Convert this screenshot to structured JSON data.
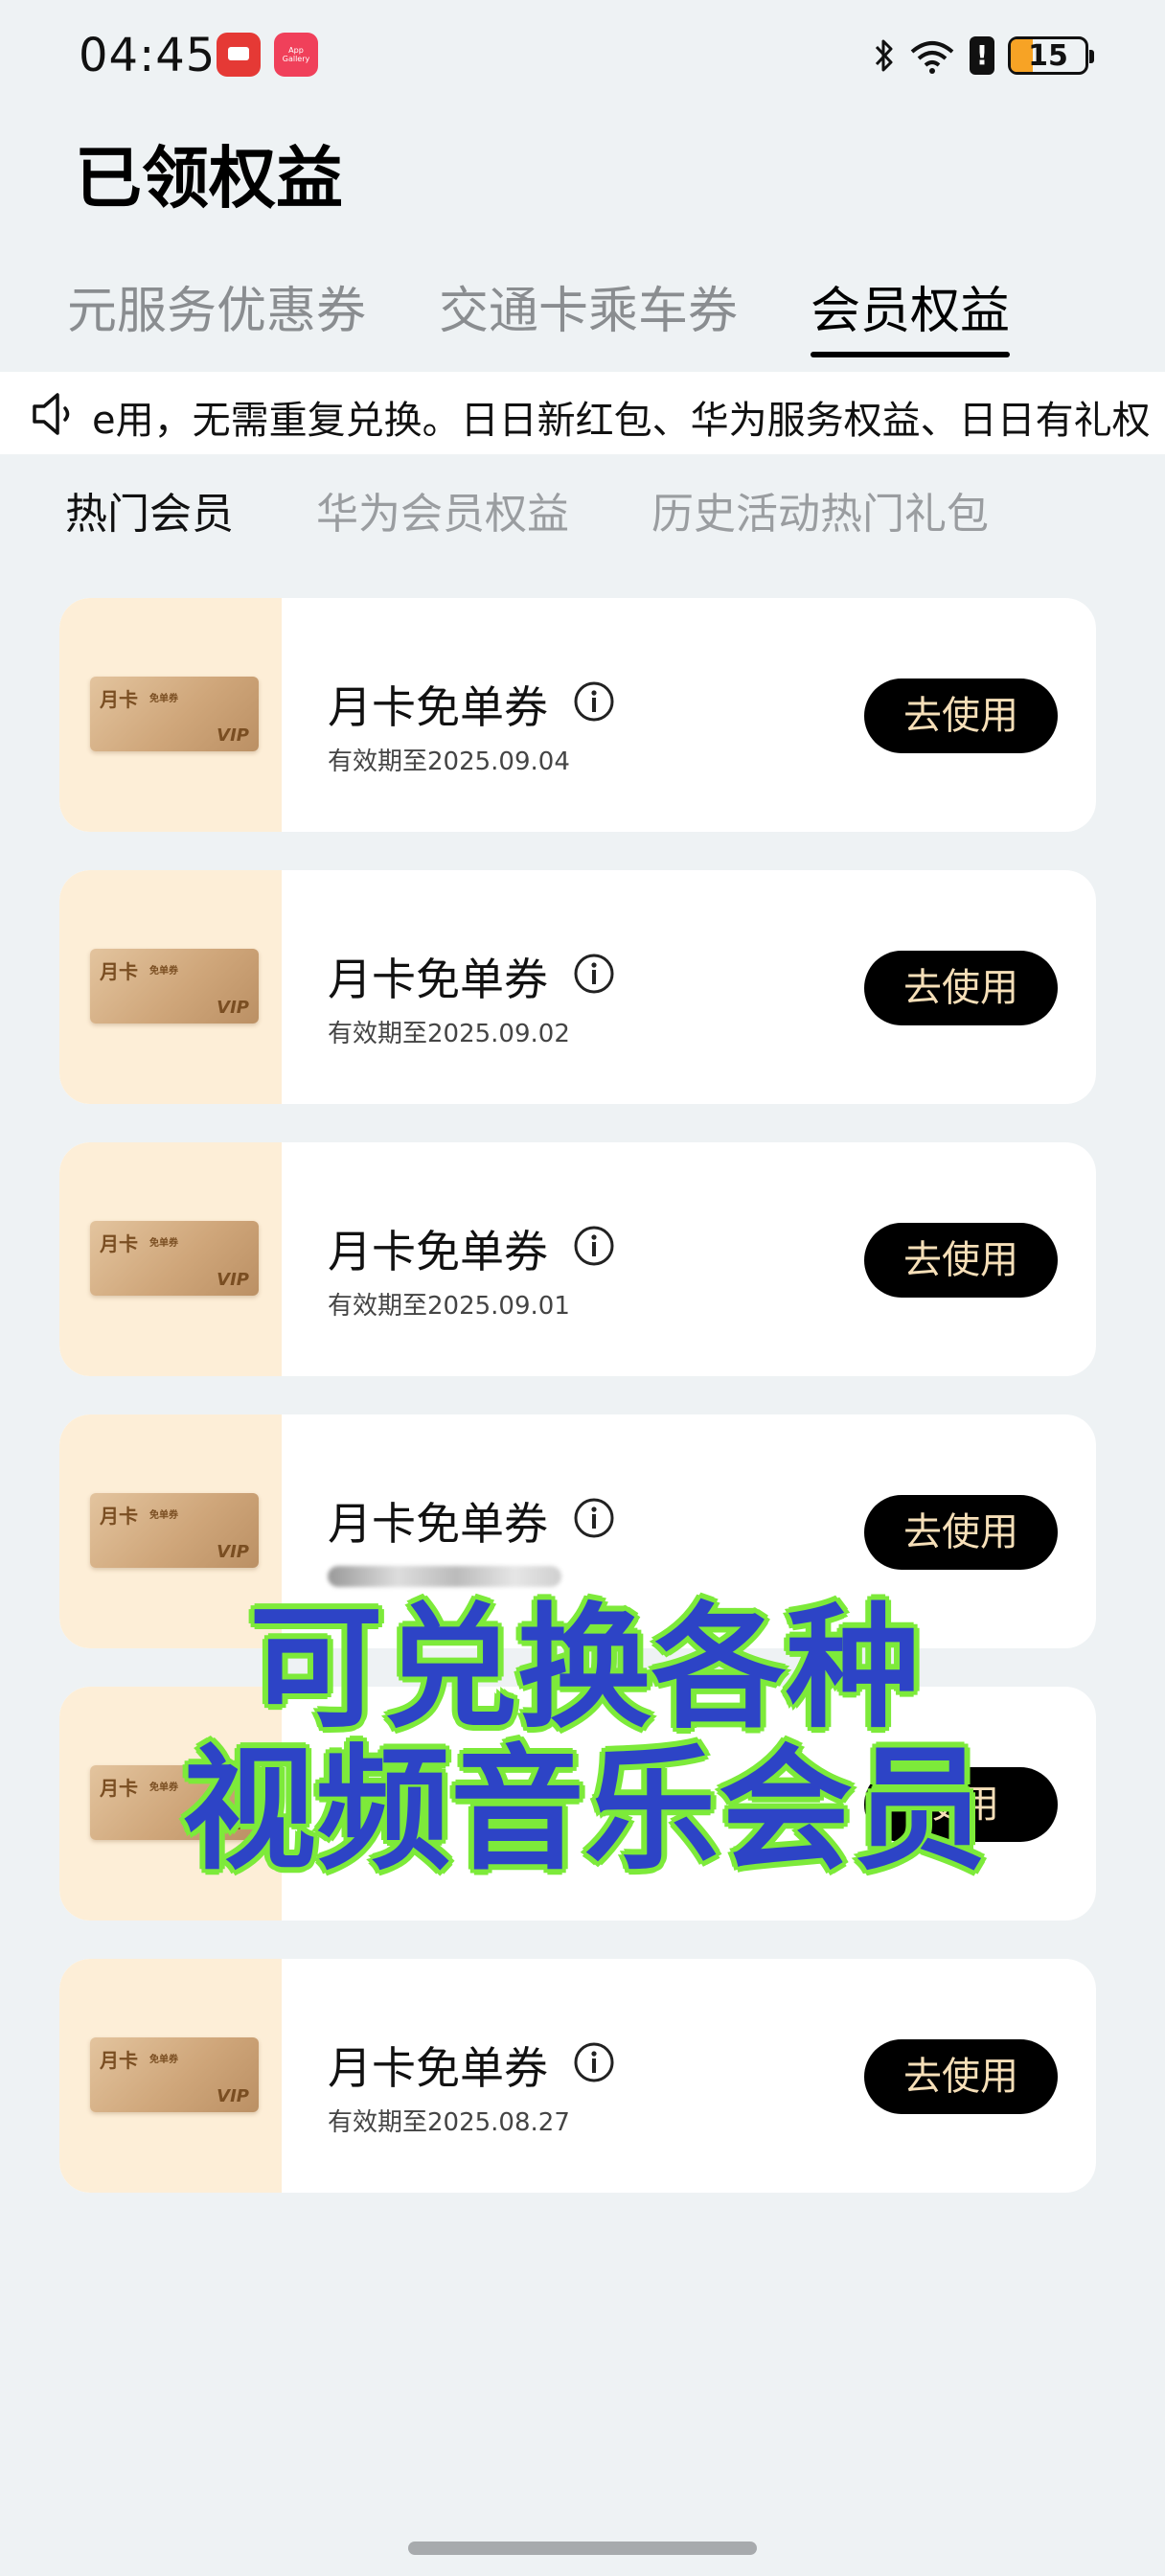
{
  "status_bar": {
    "time": "04:45",
    "battery": "15",
    "app_badge_2": "App Gallery"
  },
  "page": {
    "title": "已领权益"
  },
  "top_tabs": [
    {
      "label": "元服务优惠券",
      "active": false
    },
    {
      "label": "交通卡乘车券",
      "active": false
    },
    {
      "label": "会员权益",
      "active": true
    }
  ],
  "marquee": {
    "text": "e用，无需重复兑换。日日新红包、华为服务权益、日日有礼权"
  },
  "sub_tabs": [
    {
      "label": "热门会员",
      "active": true
    },
    {
      "label": "华为会员权益",
      "active": false
    },
    {
      "label": "历史活动热门礼包",
      "active": false
    }
  ],
  "card_art": {
    "title": "月卡",
    "sub": "免单券",
    "vip": "VIP"
  },
  "coupons": [
    {
      "name": "月卡免单券",
      "expiry": "有效期至2025.09.04",
      "button": "去使用"
    },
    {
      "name": "月卡免单券",
      "expiry": "有效期至2025.09.02",
      "button": "去使用"
    },
    {
      "name": "月卡免单券",
      "expiry": "有效期至2025.09.01",
      "button": "去使用"
    },
    {
      "name": "月卡免单券",
      "expiry": "",
      "button": "去使用"
    },
    {
      "name": "",
      "expiry": "",
      "button": "使用"
    },
    {
      "name": "月卡免单券",
      "expiry": "有效期至2025.08.27",
      "button": "去使用"
    }
  ],
  "overlay": {
    "line1": "可兑换各种",
    "line2": "视频音乐会员"
  },
  "colors": {
    "accent_tab": "#000000",
    "button_bg": "#000000",
    "button_text": "#f6dfb8",
    "card_art_bg": "#fdeed7",
    "overlay_fill": "#2d44c6",
    "overlay_stroke": "#7dea3a"
  }
}
